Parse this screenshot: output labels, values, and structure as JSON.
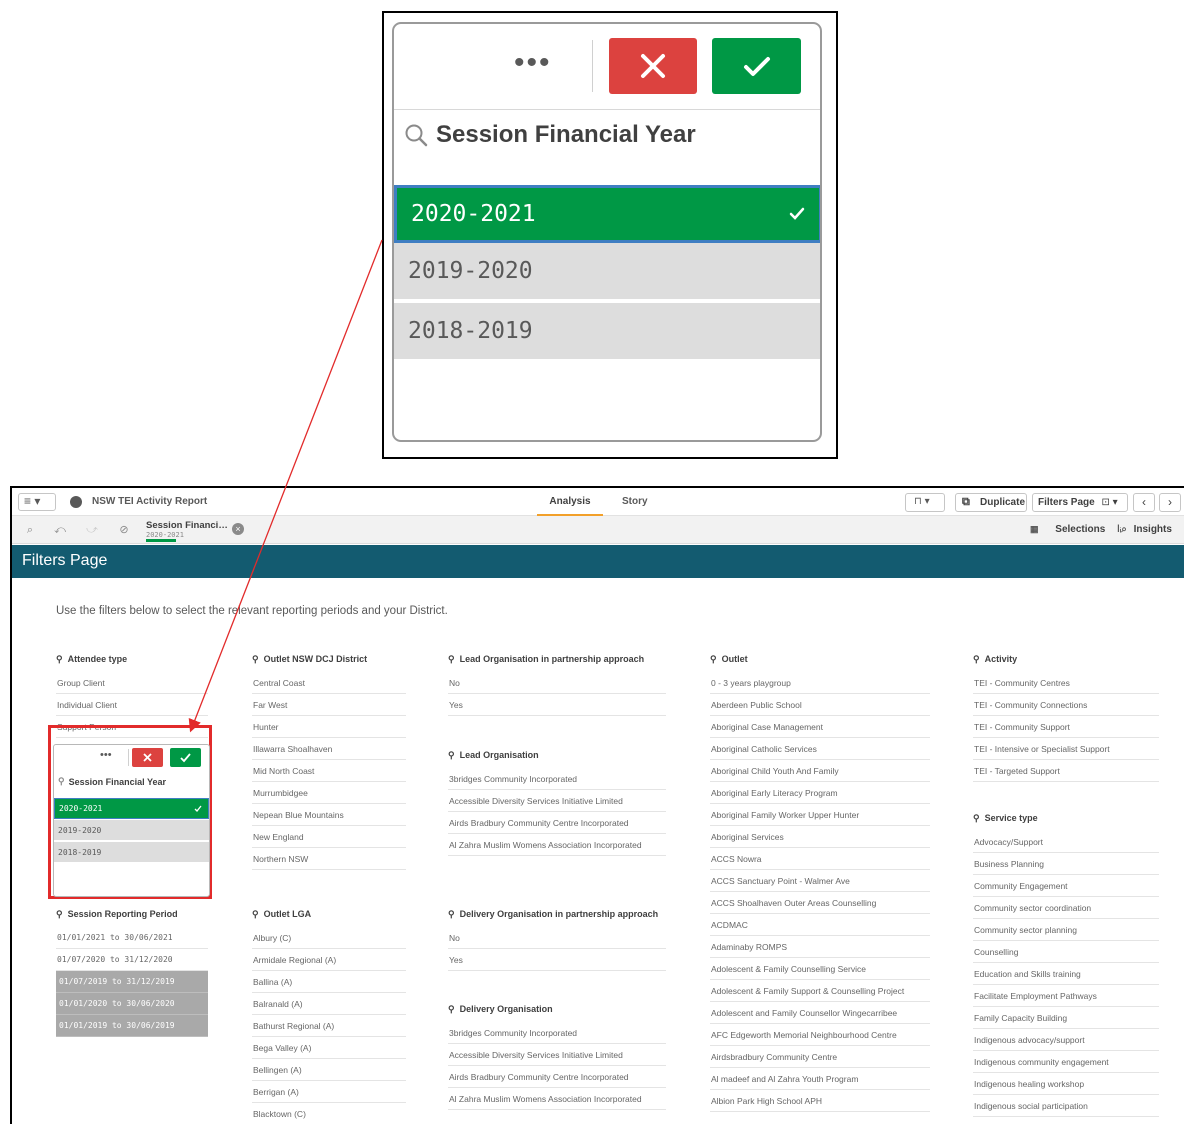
{
  "zoom": {
    "more_label": "•••",
    "title": "Session Financial Year",
    "rows": [
      "2020-2021",
      "2019-2020",
      "2018-2019"
    ]
  },
  "topbar": {
    "menu_label": "≡ ▾",
    "app_title": "NSW TEI Activity Report",
    "tabs": [
      "Analysis",
      "Story"
    ],
    "bookmark_label": "⊓ ▾",
    "duplicate_label": "Duplicate",
    "page_label": "Filters Page",
    "page_suffix": "⊡ ▾",
    "prev": "‹",
    "next": "›"
  },
  "selbar": {
    "chip_name": "Session Financi…",
    "chip_value": "2020-2021",
    "chip_clear": "×",
    "selections_label": "Selections",
    "insights_label": "Insights"
  },
  "sheet": {
    "title": "Filters Page",
    "intro": "Use the filters below to select the relevant reporting periods and your District."
  },
  "panes": {
    "attendee_type": {
      "title": "Attendee type",
      "items": [
        "Group Client",
        "Individual Client",
        "Support Person"
      ]
    },
    "session_fy": {
      "more": "•••",
      "title": "Session Financial Year",
      "rows": [
        "2020-2021",
        "2019-2020",
        "2018-2019"
      ]
    },
    "session_reporting_period": {
      "title": "Session Reporting Period",
      "items": [
        "01/01/2021 to 30/06/2021",
        "01/07/2020 to 31/12/2020",
        "01/07/2019 to 31/12/2019",
        "01/01/2020 to 30/06/2020",
        "01/01/2019 to 30/06/2019"
      ]
    },
    "district": {
      "title": "Outlet NSW DCJ District",
      "items": [
        "Central Coast",
        "Far West",
        "Hunter",
        "Illawarra Shoalhaven",
        "Mid North Coast",
        "Murrumbidgee",
        "Nepean Blue Mountains",
        "New England",
        "Northern NSW"
      ]
    },
    "lga": {
      "title": "Outlet LGA",
      "items": [
        "Albury (C)",
        "Armidale Regional (A)",
        "Ballina (A)",
        "Balranald (A)",
        "Bathurst Regional (A)",
        "Bega Valley (A)",
        "Bellingen (A)",
        "Berrigan (A)",
        "Blacktown (C)"
      ]
    },
    "lead_org_partnership": {
      "title": "Lead Organisation in partnership approach",
      "items": [
        "No",
        "Yes"
      ]
    },
    "lead_org": {
      "title": "Lead Organisation",
      "items": [
        "3bridges Community Incorporated",
        "Accessible Diversity Services Initiative Limited",
        "Airds Bradbury Community Centre Incorporated",
        "Al Zahra Muslim Womens Association Incorporated"
      ]
    },
    "delivery_org_partnership": {
      "title": "Delivery Organisation in partnership approach",
      "items": [
        "No",
        "Yes"
      ]
    },
    "delivery_org": {
      "title": "Delivery Organisation",
      "items": [
        "3bridges Community Incorporated",
        "Accessible Diversity Services Initiative Limited",
        "Airds Bradbury Community Centre Incorporated",
        "Al Zahra Muslim Womens Association Incorporated"
      ]
    },
    "outlet": {
      "title": "Outlet",
      "items": [
        "0 - 3 years playgroup",
        "Aberdeen Public School",
        "Aboriginal Case Management",
        "Aboriginal Catholic Services",
        "Aboriginal Child Youth And Family",
        "Aboriginal Early Literacy Program",
        "Aboriginal Family Worker Upper Hunter",
        "Aboriginal Services",
        "ACCS Nowra",
        "ACCS Sanctuary Point - Walmer Ave",
        "ACCS Shoalhaven Outer Areas Counselling",
        "ACDMAC",
        "Adaminaby ROMPS",
        "Adolescent & Family Counselling Service",
        "Adolescent & Family Support & Counselling Project",
        "Adolescent and Family Counsellor Wingecarribee",
        "AFC Edgeworth Memorial Neighbourhood Centre",
        "Airdsbradbury Community Centre",
        "Al madeef and Al Zahra Youth Program",
        "Albion Park High School APH"
      ]
    },
    "activity": {
      "title": "Activity",
      "items": [
        "TEI - Community Centres",
        "TEI - Community Connections",
        "TEI - Community Support",
        "TEI - Intensive or Specialist Support",
        "TEI - Targeted Support"
      ]
    },
    "service_type": {
      "title": "Service type",
      "items": [
        "Advocacy/Support",
        "Business Planning",
        "Community Engagement",
        "Community sector coordination",
        "Community sector planning",
        "Counselling",
        "Education and Skills training",
        "Facilitate Employment Pathways",
        "Family Capacity Building",
        "Indigenous advocacy/support",
        "Indigenous community engagement",
        "Indigenous healing workshop",
        "Indigenous social participation"
      ]
    }
  },
  "colors": {
    "selected": "#009845",
    "cancel": "#dc423f",
    "header": "#135b70",
    "excluded": "#a9a9a9",
    "alternative": "#dddddd",
    "highlight": "#e22b2b"
  }
}
